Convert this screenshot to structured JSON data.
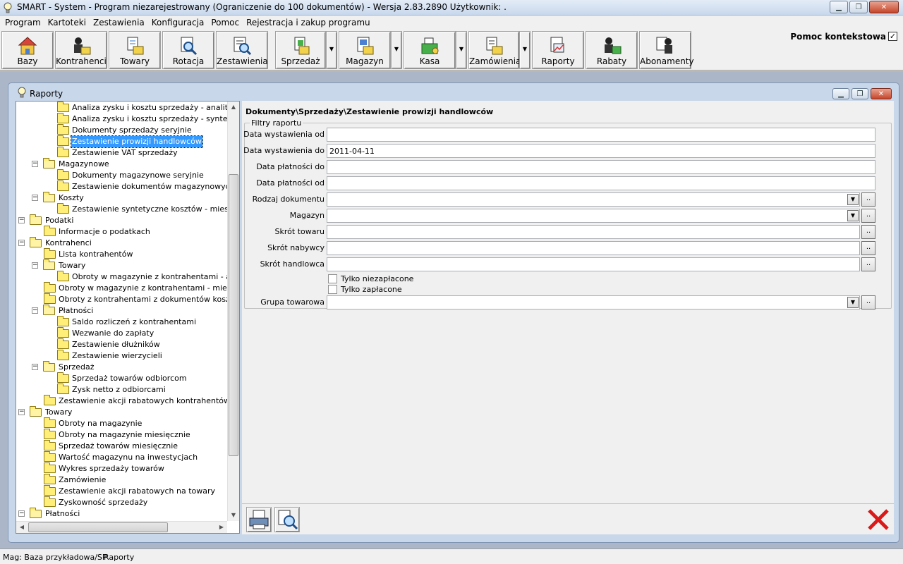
{
  "window": {
    "title": "SMART - System - Program niezarejestrowany (Ograniczenie do 100 dokumentów) - Wersja 2.83.2890     Użytkownik: ."
  },
  "menu": [
    "Program",
    "Kartoteki",
    "Zestawienia",
    "Konfiguracja",
    "Pomoc",
    "Rejestracja i zakup programu"
  ],
  "toolbar": {
    "buttons": [
      "Bazy",
      "Kontrahenci",
      "Towary",
      "Rotacja",
      "Zestawienia",
      "Sprzedaż",
      "Magazyn",
      "Kasa",
      "Zamówienia",
      "Raporty",
      "Rabaty",
      "Abonamenty"
    ],
    "context_help_label": "Pomoc kontekstowa",
    "context_help_checked": "✓"
  },
  "child_window": {
    "title": "Raporty"
  },
  "tree": [
    {
      "text": "Analiza zysku i kosztu sprzedaży - analitycznie"
    },
    {
      "text": "Analiza zysku i kosztu sprzedaży - syntetycznie"
    },
    {
      "text": "Dokumenty sprzedaży seryjnie"
    },
    {
      "text": "Zestawienie prowizji handlowców"
    },
    {
      "text": "Zestawienie VAT sprzedaży"
    },
    {
      "text": "Magazynowe"
    },
    {
      "text": "Dokumenty magazynowe seryjnie"
    },
    {
      "text": "Zestawienie dokumentów magazynowych"
    },
    {
      "text": "Koszty"
    },
    {
      "text": "Zestawienie syntetyczne kosztów - miesięcznie"
    },
    {
      "text": "Podatki"
    },
    {
      "text": "Informacje o podatkach"
    },
    {
      "text": "Kontrahenci"
    },
    {
      "text": "Lista kontrahentów"
    },
    {
      "text": "Towary"
    },
    {
      "text": "Obroty w magazynie z kontrahentami - analitycz"
    },
    {
      "text": "Obroty w magazynie z kontrahentami - miesięcznie"
    },
    {
      "text": "Obroty z kontrahentami z dokumentów kosztowych"
    },
    {
      "text": "Płatności"
    },
    {
      "text": "Saldo rozliczeń z kontrahentami"
    },
    {
      "text": "Wezwanie do zapłaty"
    },
    {
      "text": "Zestawienie dłużników"
    },
    {
      "text": "Zestawienie wierzycieli"
    },
    {
      "text": "Sprzedaż"
    },
    {
      "text": "Sprzedaż towarów odbiorcom"
    },
    {
      "text": "Zysk netto z odbiorcami"
    },
    {
      "text": "Zestawienie akcji rabatowych kontrahentów"
    },
    {
      "text": "Towary"
    },
    {
      "text": "Obroty na magazynie"
    },
    {
      "text": "Obroty na magazynie miesięcznie"
    },
    {
      "text": "Sprzedaż towarów miesięcznie"
    },
    {
      "text": "Wartość magazynu na inwestycjach"
    },
    {
      "text": "Wykres sprzedaży towarów"
    },
    {
      "text": "Zamówienie"
    },
    {
      "text": "Zestawienie akcji rabatowych na towary"
    },
    {
      "text": "Zyskowność sprzedaży"
    },
    {
      "text": "Płatności"
    }
  ],
  "report": {
    "breadcrumb": "Dokumenty\\Sprzedaży\\Zestawienie prowizji handlowców",
    "filters_legend": "Filtry raportu",
    "fields": [
      {
        "label": "Data wystawienia od",
        "value": ""
      },
      {
        "label": "Data wystawienia do",
        "value": "2011-04-11"
      },
      {
        "label": "Data płatności do",
        "value": ""
      },
      {
        "label": "Data płatności od",
        "value": ""
      },
      {
        "label": "Rodzaj dokumentu",
        "value": ""
      },
      {
        "label": "Magazyn",
        "value": ""
      },
      {
        "label": "Skrót towaru",
        "value": ""
      },
      {
        "label": "Skrót nabywcy",
        "value": ""
      },
      {
        "label": "Skrót handlowca",
        "value": ""
      }
    ],
    "checkboxes": [
      "Tylko niezapłacone",
      "Tylko zapłacone"
    ],
    "group_field": {
      "label": "Grupa towarowa",
      "value": ""
    },
    "dots_label": "..",
    "dropdown_arrow": "▼"
  },
  "statusbar": {
    "mag": "Mag: Baza przykładowa/SP",
    "module": "Raporty"
  }
}
